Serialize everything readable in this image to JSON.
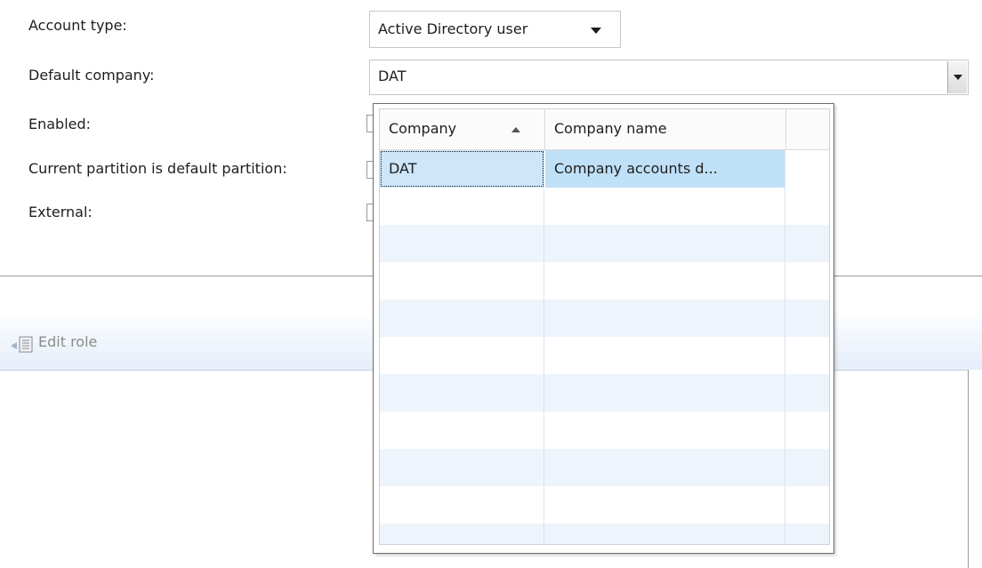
{
  "form": {
    "account_type_label": "Account type:",
    "account_type_value": "Active Directory user",
    "default_company_label": "Default company:",
    "default_company_value": "DAT",
    "enabled_label": "Enabled:",
    "current_partition_label": "Current partition is default partition:",
    "external_label": "External:"
  },
  "toolbar": {
    "edit_role_label": "Edit role"
  },
  "lookup": {
    "columns": [
      "Company",
      "Company name"
    ],
    "sort_icon": "sort-ascending-icon",
    "rows": [
      {
        "company": "DAT",
        "company_name": "Company accounts d..."
      }
    ]
  },
  "colors": {
    "selection": "#bfe0f7",
    "alt_row": "#eef4fb",
    "toolbar_gradient_end": "#e6eefa"
  }
}
